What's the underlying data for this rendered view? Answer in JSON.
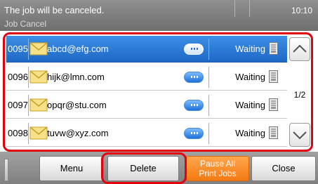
{
  "header": {
    "status_message": "The job will be canceled.",
    "screen_title": "Job Cancel",
    "time": "10:10"
  },
  "jobs": [
    {
      "id": "0095",
      "destination": "abcd@efg.com",
      "status": "Waiting",
      "selected": true
    },
    {
      "id": "0096",
      "destination": "hijk@lmn.com",
      "status": "Waiting",
      "selected": false
    },
    {
      "id": "0097",
      "destination": "opqr@stu.com",
      "status": "Waiting",
      "selected": false
    },
    {
      "id": "0098",
      "destination": "tuvw@xyz.com",
      "status": "Waiting",
      "selected": false
    }
  ],
  "pagination": {
    "indicator": "1/2"
  },
  "buttons": {
    "menu": "Menu",
    "delete": "Delete",
    "pause_line1": "Pause All",
    "pause_line2": "Print Jobs",
    "close": "Close"
  },
  "colors": {
    "selection": "#1e68c6",
    "highlight_frame": "#e3000f",
    "pause_button": "#f47a12"
  },
  "icons": [
    "envelope-icon",
    "detail-button-icon",
    "document-icon",
    "chevron-up-icon",
    "chevron-down-icon"
  ]
}
